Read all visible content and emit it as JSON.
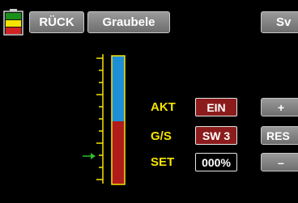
{
  "header": {
    "back_label": "RÜCK",
    "title": "Graubele",
    "sv_label": "Sv"
  },
  "battery": {
    "level_fraction": 0.67,
    "colors": [
      "#1a8f1a",
      "#f5e400",
      "#d32222"
    ]
  },
  "servo_bar": {
    "position_fraction": 0.55,
    "upper_color": "#1e8fd6",
    "lower_color": "#b01c1c",
    "border_color": "#f5e400",
    "arrow_color": "#2bbd2b"
  },
  "params": [
    {
      "label": "AKT",
      "value": "EIN"
    },
    {
      "label": "G/S",
      "value": "SW 3"
    },
    {
      "label": "SET",
      "value": "000%"
    }
  ],
  "side_buttons": {
    "plus": "+",
    "res": "RES",
    "minus": "–"
  }
}
